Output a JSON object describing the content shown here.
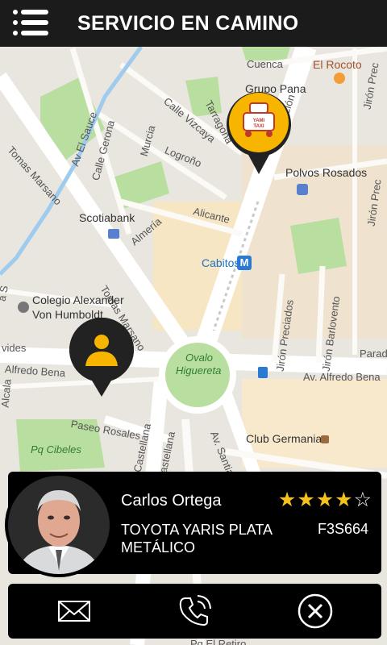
{
  "header": {
    "title": "SERVICIO EN CAMINO",
    "menu_icon": "hamburger-menu-icon"
  },
  "map": {
    "streets": {
      "cuenca": "Cuenca",
      "tarragona": "Tarragona",
      "calle_vizcaya": "Calle Vizcaya",
      "murcia": "Murcia",
      "logrono": "Logroño",
      "av_el_sauce": "Av El Sauce",
      "calle_gerona": "Calle Gerona",
      "tomas_marsano_1": "Tomas Marsano",
      "tomas_marsano_2": "Tomas Marsano",
      "alicante": "Alicante",
      "almeria": "Almería",
      "av_aviacion": "Av. Aviación",
      "jiron_precados_top": "Jirón Prec",
      "jiron_precados_right": "Jirón Prec",
      "jiron_preciados": "Jirón Preciados",
      "jiron_barlovento": "Jirón Barlovento",
      "av_alfredo_benavides_right": "Av. Alfredo Bena",
      "alfredo_benavides_left": "Alfredo Bena",
      "vides": "vides",
      "parade": "Parade",
      "paseo_rosales": "Paseo Rosales",
      "castellana_1": "Castellana",
      "castellana_2": "Castellana",
      "av_santiago": "Av. Santiago",
      "alcala": "Alcala",
      "pq_el_retiro": "Pq El Retiro",
      "s_label": "a S"
    },
    "places": {
      "el_rocoto": "El Rocoto",
      "grupo_pana": "Grupo Pana",
      "polvos_rosados": "Polvos Rosados",
      "scotiabank": "Scotiabank",
      "cabitos": "Cabitos",
      "colegio_line1": "Colegio Alexander",
      "colegio_line2": "Von Humboldt",
      "ovalo_line1": "Ovalo",
      "ovalo_line2": "Higuereta",
      "club_germania": "Club Germania",
      "pq_cibeles": "Pq Cibeles"
    },
    "taxi_sign": "YAMI TAXI"
  },
  "driver": {
    "name": "Carlos Ortega",
    "car": "TOYOTA YARIS PLATA METÁLICO",
    "plate": "F3S664",
    "rating": 4,
    "rating_max": 5,
    "star_color": "#f4c21b"
  },
  "actions": [
    {
      "name": "message-button",
      "icon": "envelope-icon"
    },
    {
      "name": "call-button",
      "icon": "phone-icon"
    },
    {
      "name": "cancel-button",
      "icon": "close-circle-icon"
    }
  ],
  "colors": {
    "header_bg": "#1b1b1b",
    "pin_yellow": "#f7b500",
    "pin_dark": "#222222"
  }
}
